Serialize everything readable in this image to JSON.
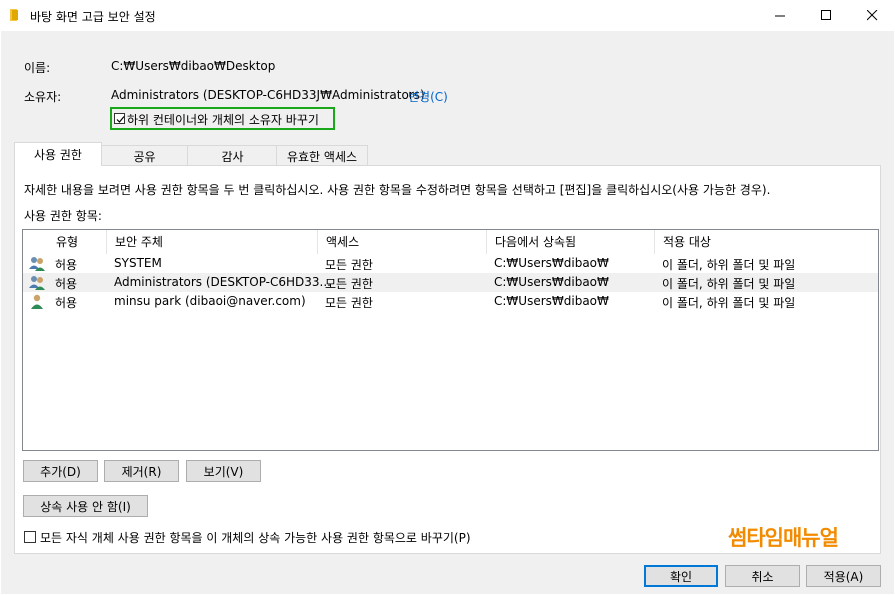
{
  "window": {
    "title": "바탕 화면 고급 보안 설정",
    "min_label": "—",
    "max_label": "☐",
    "close_label": "✕"
  },
  "info": {
    "name_label": "이름:",
    "name_value": "C:₩Users₩dibao₩Desktop",
    "owner_label": "소유자:",
    "owner_value": "Administrators (DESKTOP-C6HD33J₩Administrators)",
    "owner_change_link": "변경(C)",
    "replace_owner_checkbox_label": "하위 컨테이너와 개체의 소유자 바꾸기",
    "replace_owner_checked": true
  },
  "tabs": [
    {
      "label": "사용 권한",
      "active": true
    },
    {
      "label": "공유",
      "active": false
    },
    {
      "label": "감사",
      "active": false
    },
    {
      "label": "유효한 액세스",
      "active": false
    }
  ],
  "permissions": {
    "instructions": "자세한 내용을 보려면 사용 권한 항목을 두 번 클릭하십시오. 사용 권한 항목을 수정하려면 항목을 선택하고 [편집]을 클릭하십시오(사용 가능한 경우).",
    "entries_label": "사용 권한 항목:",
    "columns": [
      "유형",
      "보안 주체",
      "액세스",
      "다음에서 상속됨",
      "적용 대상"
    ],
    "rows": [
      {
        "icon": "group-users-icon",
        "type": "허용",
        "principal": "SYSTEM",
        "access": "모든 권한",
        "inherited": "C:₩Users₩dibao₩",
        "applies": "이 폴더, 하위 폴더 및 파일",
        "selected": false
      },
      {
        "icon": "group-users-icon",
        "type": "허용",
        "principal": "Administrators (DESKTOP-C6HD33...",
        "access": "모든 권한",
        "inherited": "C:₩Users₩dibao₩",
        "applies": "이 폴더, 하위 폴더 및 파일",
        "selected": true
      },
      {
        "icon": "single-user-icon",
        "type": "허용",
        "principal": "minsu park (dibaoi@naver.com)",
        "access": "모든 권한",
        "inherited": "C:₩Users₩dibao₩",
        "applies": "이 폴더, 하위 폴더 및 파일",
        "selected": false
      }
    ],
    "add_button": "추가(D)",
    "remove_button": "제거(R)",
    "view_button": "보기(V)",
    "disable_inheritance_button": "상속 사용 안 함(I)",
    "replace_child_checkbox_label": "모든 자식 개체 사용 권한 항목을 이 개체의 상속 가능한 사용 권한 항목으로 바꾸기(P)",
    "replace_child_checked": false
  },
  "footer": {
    "ok_button": "확인",
    "cancel_button": "취소",
    "apply_button": "적용(A)"
  },
  "watermark": "썸타임매뉴얼",
  "colors": {
    "highlight_box": "#1aa81a",
    "link": "#0066cc",
    "watermark": "#f28b00",
    "default_button_border": "#0078d7"
  }
}
